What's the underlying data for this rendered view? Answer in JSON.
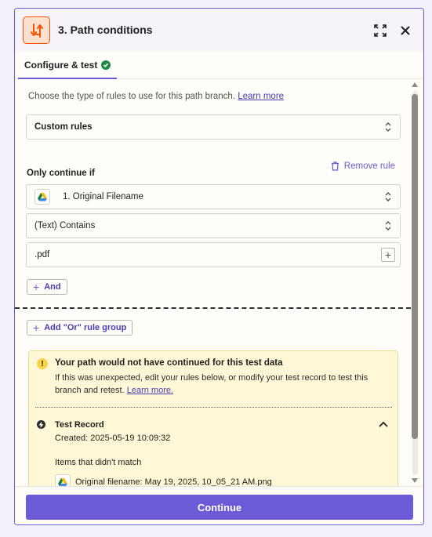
{
  "header": {
    "title": "3. Path conditions"
  },
  "tabs": [
    {
      "label": "Configure & test",
      "status": "complete"
    }
  ],
  "rule_type": {
    "hint": "Choose the type of rules to use for this path branch.",
    "learn_more": "Learn more",
    "selected": "Custom rules"
  },
  "condition": {
    "label": "Only continue if",
    "remove_label": "Remove rule",
    "field": "1. Original Filename",
    "operator": "(Text) Contains",
    "value": ".pdf",
    "and_label": "And",
    "or_group_label": "Add \"Or\" rule group"
  },
  "alert": {
    "title": "Your path would not have continued for this test data",
    "body": "If this was unexpected, edit your rules below, or modify your test record to test this branch and retest.",
    "learn_more": "Learn more.",
    "record_title": "Test Record",
    "record_created": "Created: 2025-05-19 10:09:32",
    "nomatch_label": "Items that didn't match",
    "nomatch_item": "Original filename: May 19, 2025, 10_05_21 AM.png"
  },
  "footer": {
    "continue_label": "Continue"
  },
  "colors": {
    "accent": "#6b5bd6",
    "zapier_orange": "#ff4f00",
    "success": "#1c8a42",
    "warning_bg": "#fff8d6"
  }
}
